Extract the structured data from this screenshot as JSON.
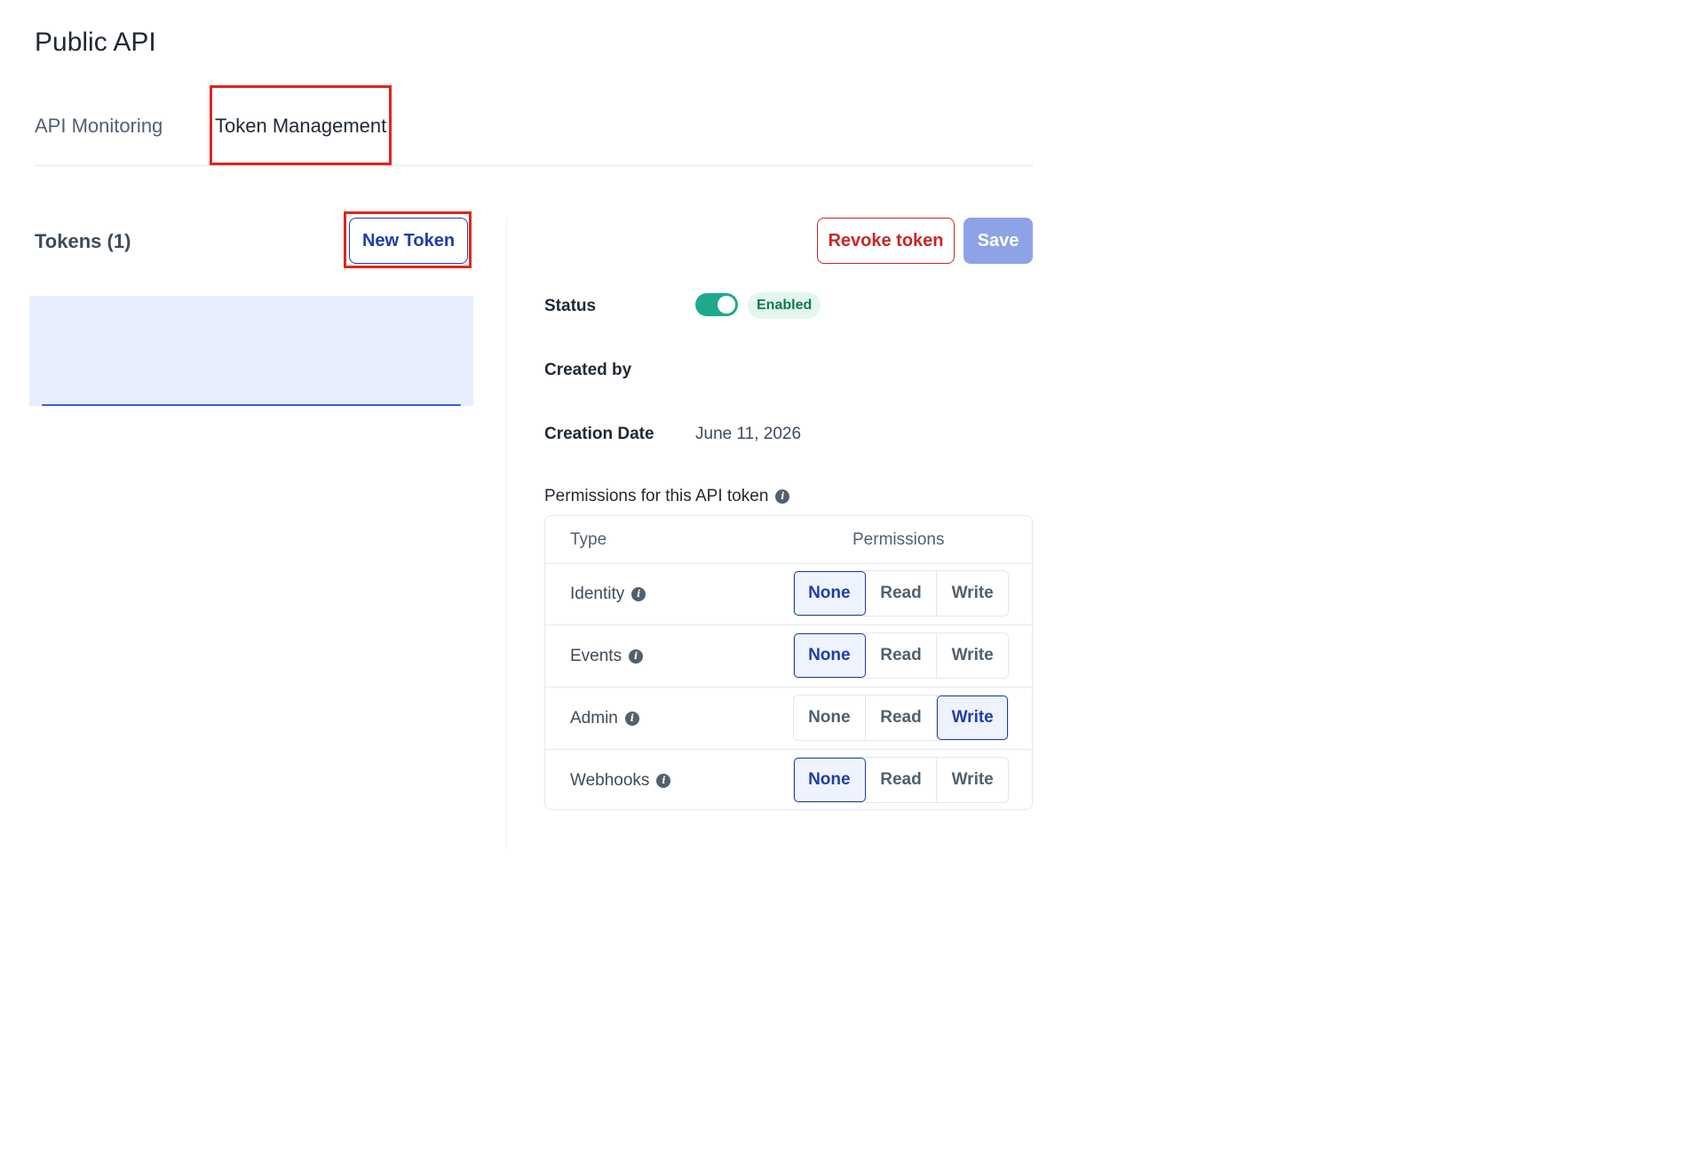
{
  "page": {
    "title": "Public API"
  },
  "tabs": [
    {
      "label": "API Monitoring",
      "active": false
    },
    {
      "label": "Token Management",
      "active": true
    }
  ],
  "tokens": {
    "title": "Tokens (1)",
    "new_token_label": "New Token"
  },
  "actions": {
    "revoke_label": "Revoke token",
    "save_label": "Save"
  },
  "details": {
    "status_label": "Status",
    "status_enabled": true,
    "status_badge": "Enabled",
    "created_by_label": "Created by",
    "created_by_value": "",
    "creation_date_label": "Creation Date",
    "creation_date_value": "June 11, 2026"
  },
  "permissions": {
    "heading": "Permissions for this API token",
    "col_type": "Type",
    "col_permissions": "Permissions",
    "options": [
      "None",
      "Read",
      "Write"
    ],
    "rows": [
      {
        "type": "Identity",
        "selected": "None"
      },
      {
        "type": "Events",
        "selected": "None"
      },
      {
        "type": "Admin",
        "selected": "Write"
      },
      {
        "type": "Webhooks",
        "selected": "None"
      }
    ]
  },
  "colors": {
    "accent": "#1f3ea8",
    "danger": "#c62828",
    "toggle_on": "#1fa98c",
    "highlight": "#e0251b"
  },
  "icons": {
    "info": "info-icon"
  }
}
